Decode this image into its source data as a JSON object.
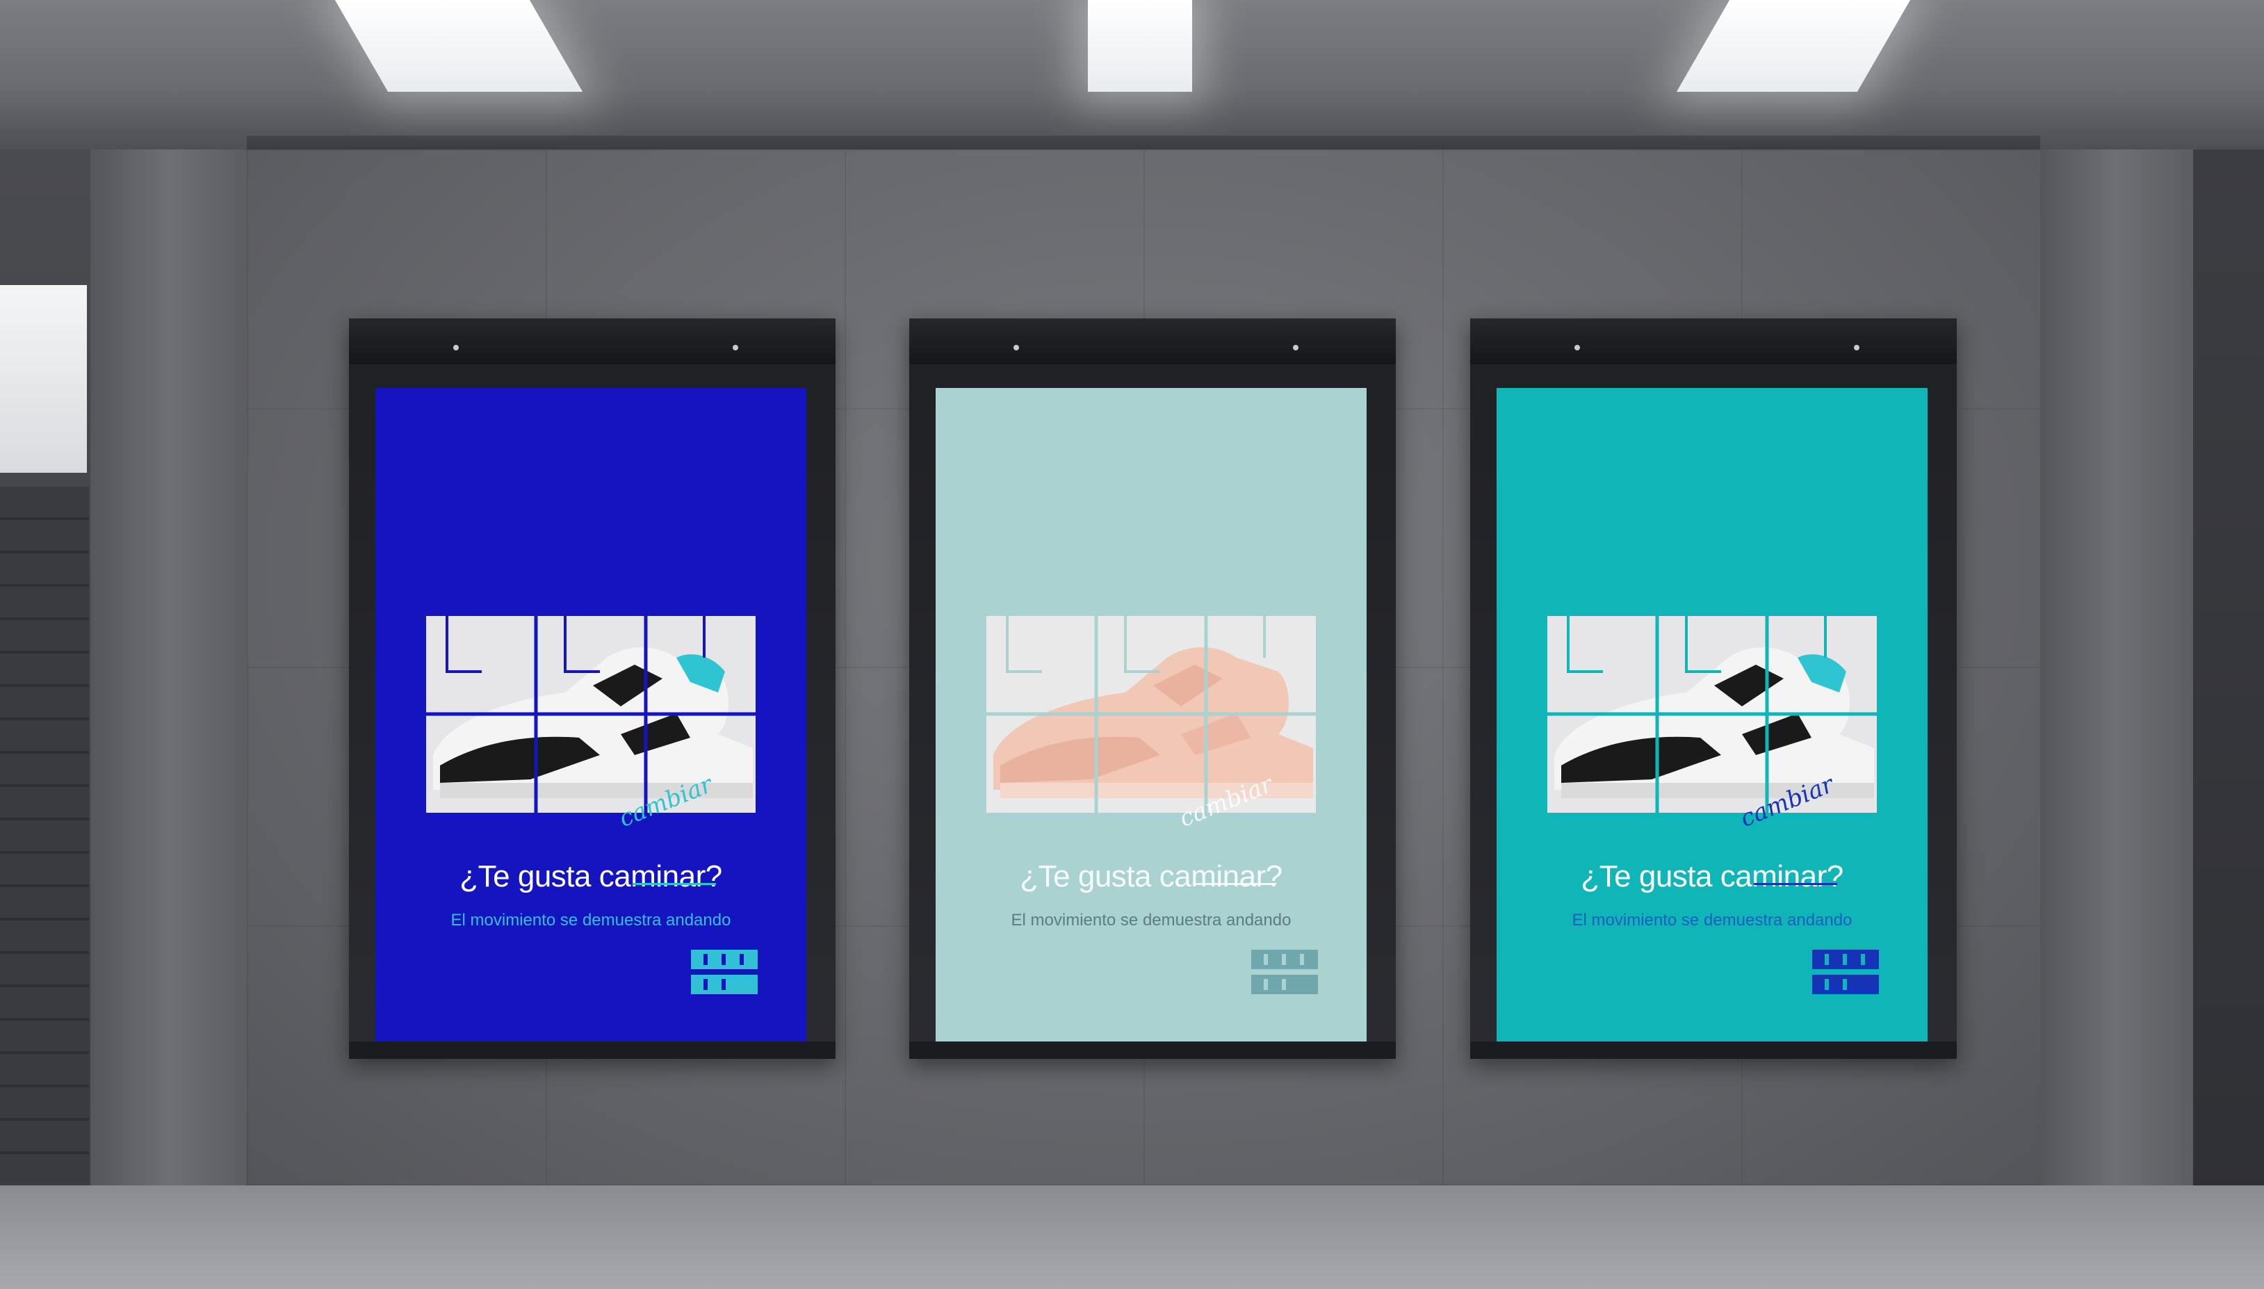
{
  "scene": {
    "posters": [
      {
        "headline": "¿Te gusta caminar?",
        "handwritten": "cambiar",
        "subline": "El movimiento se demuestra andando",
        "background": "#1515c0",
        "accent": "#2fc4d1",
        "shoe_colors": [
          "#ffffff",
          "#1a1a1a",
          "#2fc4d1"
        ]
      },
      {
        "headline": "¿Te gusta caminar?",
        "handwritten": "cambiar",
        "subline": "El movimiento se demuestra andando",
        "background": "#a9d2d0",
        "accent": "#ffffff",
        "shoe_colors": [
          "#f1c7b5",
          "#e8b29f",
          "#ffffff"
        ]
      },
      {
        "headline": "¿Te gusta caminar?",
        "handwritten": "cambiar",
        "subline": "El movimiento se demuestra andando",
        "background": "#0fb5b7",
        "accent": "#1533b6",
        "shoe_colors": [
          "#ffffff",
          "#1a1a1a",
          "#2fc4d1"
        ]
      }
    ]
  }
}
